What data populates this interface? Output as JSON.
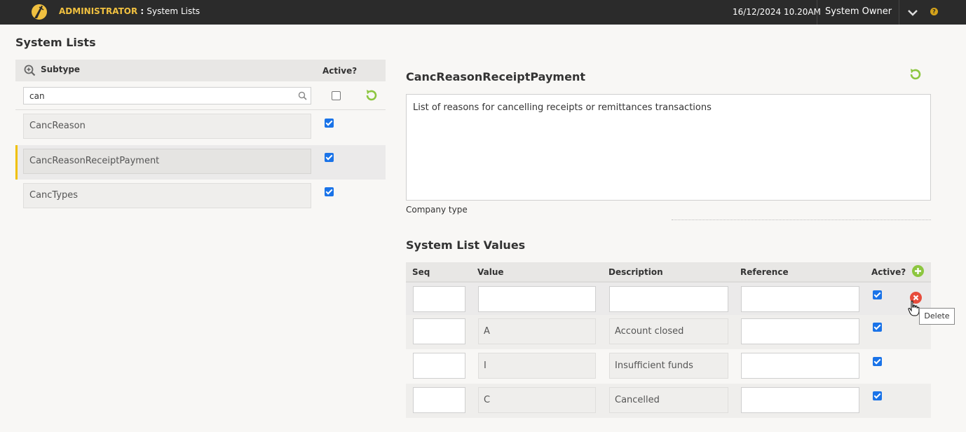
{
  "topbar": {
    "role": "ADMINISTRATOR",
    "separator": " : ",
    "page": "System Lists",
    "datetime": "16/12/2024 10.20AM",
    "user": "System Owner",
    "help_icon": "?"
  },
  "page_title": "System Lists",
  "subtype_grid": {
    "col_subtype": "Subtype",
    "col_active": "Active?",
    "search_value": "can",
    "rows": [
      {
        "name": "CancReason",
        "active": true,
        "selected": false
      },
      {
        "name": "CancReasonReceiptPayment",
        "active": true,
        "selected": true
      },
      {
        "name": "CancTypes",
        "active": true,
        "selected": false
      }
    ]
  },
  "detail": {
    "title": "CancReasonReceiptPayment",
    "description": "List of reasons for cancelling receipts or remittances transactions",
    "company_type_label": "Company type"
  },
  "values_section": {
    "title": "System List Values",
    "headers": {
      "seq": "Seq",
      "value": "Value",
      "description": "Description",
      "reference": "Reference",
      "active": "Active?"
    },
    "rows": [
      {
        "seq": "",
        "value": "",
        "description": "",
        "reference": "",
        "active": true
      },
      {
        "seq": "",
        "value": "A",
        "description": "Account closed",
        "reference": "",
        "active": true
      },
      {
        "seq": "",
        "value": "I",
        "description": "Insufficient funds",
        "reference": "",
        "active": true
      },
      {
        "seq": "",
        "value": "C",
        "description": "Cancelled",
        "reference": "",
        "active": true
      }
    ],
    "delete_tooltip": "Delete"
  },
  "colors": {
    "topbar_bg": "#2b2b2b",
    "accent_gold": "#f0c040",
    "selected_marker": "#f0c000",
    "refresh_green": "#8cc63f",
    "delete_red": "#e74c3c",
    "checkbox_blue": "#1a73e8"
  }
}
